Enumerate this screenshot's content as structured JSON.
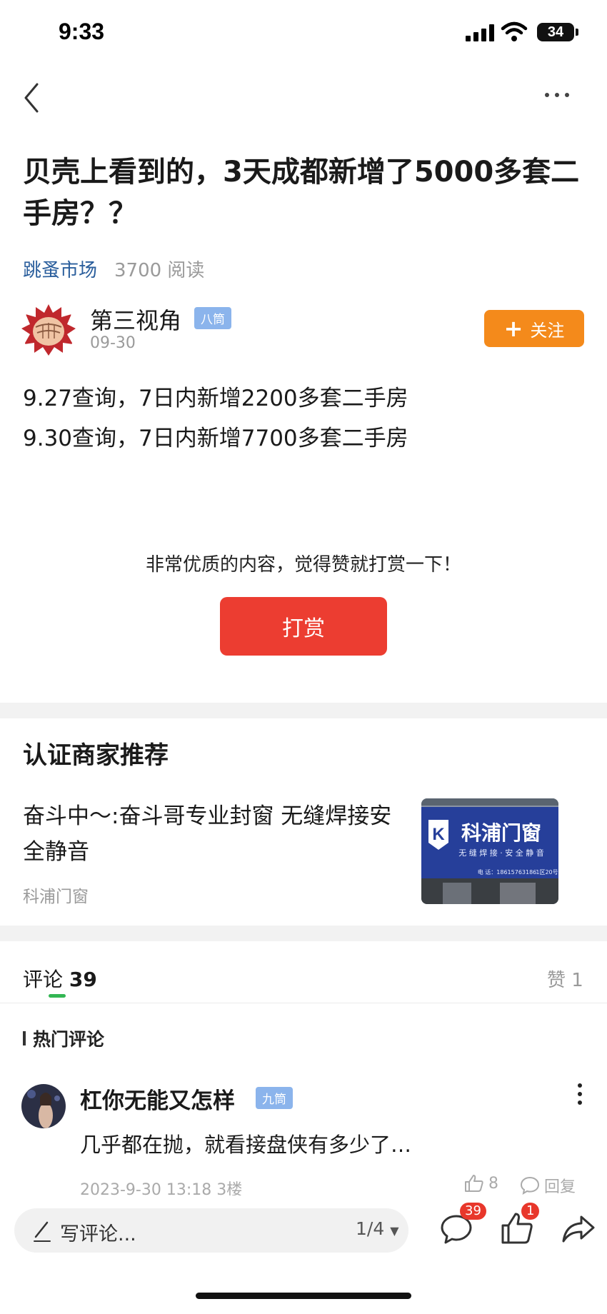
{
  "status_bar": {
    "time": "9:33",
    "battery": "34"
  },
  "post": {
    "title": "贝壳上看到的，3天成都新增了5000多套二手房？？",
    "forum": "跳蚤市场",
    "reads": "3700 阅读",
    "author": "第三视角",
    "author_level": "八筒",
    "date": "09-30",
    "follow_label": "关注",
    "body": [
      "9.27查询，7日内新增2200多套二手房",
      "9.30查询，7日内新增7700多套二手房"
    ],
    "reward_prompt": "非常优质的内容，觉得赞就打赏一下！",
    "reward_button": "打赏"
  },
  "merchant": {
    "section_title": "认证商家推荐",
    "ad_text": "奋斗中～:奋斗哥专业封窗 无缝焊接安全静音",
    "ad_name": "科浦门窗",
    "ad_image_title": "科浦门窗",
    "ad_image_subtitle": "无 缝 焊 接 · 安 全 静 音",
    "ad_image_phone": "电 话：18615763186",
    "ad_image_addr": "1区20号"
  },
  "comments": {
    "tab_label": "评论",
    "count": "39",
    "likes_label": "赞 1",
    "hot_label": "热门评论",
    "items": [
      {
        "author": "杠你无能又怎样",
        "level": "九筒",
        "text": "几乎都在抛，就看接盘侠有多少了…",
        "meta": "2023-9-30 13:18  3楼",
        "likes": "8",
        "reply_label": "回复"
      }
    ]
  },
  "bottom_bar": {
    "input_placeholder": "写评论...",
    "page": "1/4",
    "comment_badge": "39",
    "like_badge": "1"
  },
  "colors": {
    "accent_orange": "#f48a1b",
    "reward_red": "#ec3d31",
    "link_blue": "#2a5e9c",
    "level_badge": "#8bb4ec",
    "tab_green": "#33b653",
    "badge_red": "#e8372b"
  },
  "icons": [
    "back-icon",
    "more-icon",
    "plus-icon",
    "pencil-icon",
    "caret-down-icon",
    "comment-icon",
    "thumbs-up-icon",
    "share-icon",
    "reply-icon",
    "comment-more-icon"
  ]
}
